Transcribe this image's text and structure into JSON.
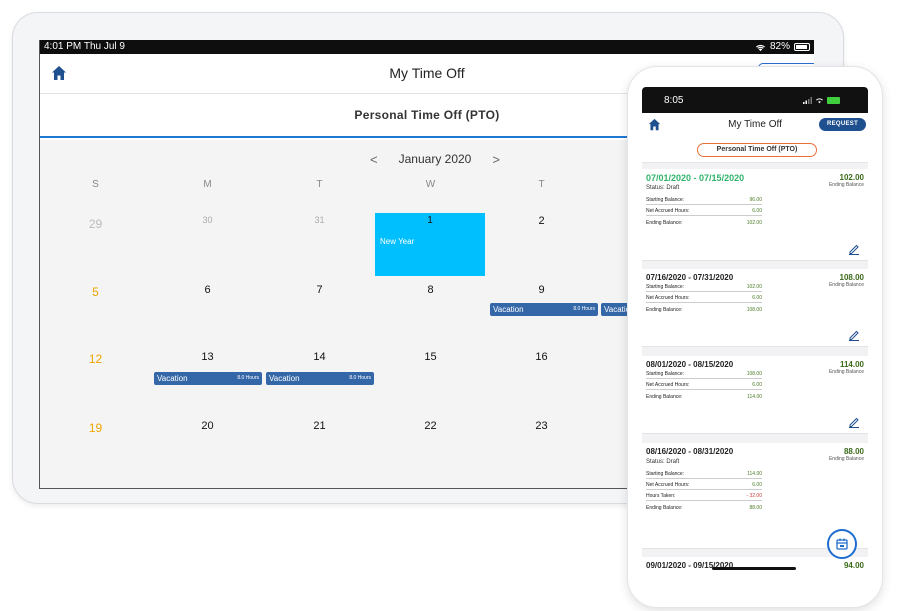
{
  "tablet": {
    "status": {
      "time": "4:01 PM  Thu Jul 9",
      "battery": "82%",
      "wifi": "wifi-icon"
    },
    "header": {
      "title": "My Time Off",
      "home_icon": "home-icon"
    },
    "subheader": "Personal Time Off (PTO)",
    "calendar": {
      "month": "January 2020",
      "prev": "<",
      "next": ">",
      "dow": [
        "S",
        "M",
        "T",
        "W",
        "T"
      ],
      "weeks": [
        [
          "29",
          "30",
          "31",
          "1",
          "2"
        ],
        [
          "5",
          "6",
          "7",
          "8",
          "9"
        ],
        [
          "12",
          "13",
          "14",
          "15",
          "16"
        ],
        [
          "19",
          "20",
          "21",
          "22",
          "23"
        ]
      ],
      "holiday": {
        "day": "1",
        "label": "New Year",
        "color": "#00bfff"
      },
      "events": [
        {
          "label": "Vacation",
          "hours": "8.0 Hours"
        },
        {
          "label": "Vacation",
          "hours": ""
        },
        {
          "label": "Vacation",
          "hours": "8.0 Hours"
        },
        {
          "label": "Vacation",
          "hours": "8.0 Hours"
        }
      ],
      "event_color": "#3467a8"
    }
  },
  "phone": {
    "status": {
      "time": "8:05"
    },
    "header": {
      "title": "My Time Off",
      "request": "REQUEST"
    },
    "subheader": "Personal Time Off (PTO)",
    "cards": [
      {
        "range": "07/01/2020 - 07/15/2020",
        "status": "Status: Draft",
        "total": "102.00",
        "total_label": "Ending Balance",
        "rows": [
          {
            "label": "Starting Balance:",
            "value": "96.00"
          },
          {
            "label": "Net Accrued Hours:",
            "value": "6.00"
          },
          {
            "label": "Ending Balance:",
            "value": "102.00"
          }
        ]
      },
      {
        "range": "07/16/2020 - 07/31/2020",
        "total": "108.00",
        "total_label": "Ending Balance",
        "rows": [
          {
            "label": "Starting Balance:",
            "value": "102.00"
          },
          {
            "label": "Net Accrued Hours:",
            "value": "6.00"
          },
          {
            "label": "Ending Balance:",
            "value": "108.00"
          }
        ]
      },
      {
        "range": "08/01/2020 - 08/15/2020",
        "total": "114.00",
        "total_label": "Ending Balance",
        "rows": [
          {
            "label": "Starting Balance:",
            "value": "108.00"
          },
          {
            "label": "Net Accrued Hours:",
            "value": "6.00"
          },
          {
            "label": "Ending Balance:",
            "value": "114.00"
          }
        ]
      },
      {
        "range": "08/16/2020 - 08/31/2020",
        "status": "Status: Draft",
        "total": "88.00",
        "total_label": "Ending Balance",
        "rows": [
          {
            "label": "Starting Balance:",
            "value": "114.00"
          },
          {
            "label": "Net Accrued Hours:",
            "value": "6.00"
          },
          {
            "label": "Hours Taken:",
            "value": "- 32.00"
          },
          {
            "label": "Ending Balance:",
            "value": "88.00"
          }
        ]
      },
      {
        "range": "09/01/2020 - 09/15/2020",
        "total": "94.00"
      }
    ],
    "colors": {
      "accent": "#1e4f8f",
      "highlight": "#e8703a",
      "positive": "#4a7a24",
      "negative": "#d23b3b",
      "draft_title": "#2fb36a"
    }
  }
}
